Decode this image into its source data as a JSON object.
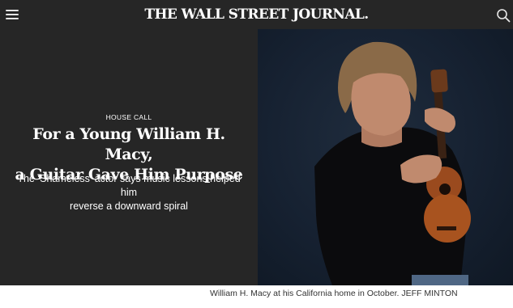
{
  "header": {
    "logo": "THE WALL STREET JOURNAL.",
    "menu_icon": "hamburger-menu-icon",
    "search_icon": "search-icon"
  },
  "article": {
    "kicker": "HOUSE CALL",
    "headline_line1": "For a Young William H. Macy,",
    "headline_line2": "a Guitar Gave Him Purpose",
    "dek_line1": "The ‘Shameless’ actor says music lessons helped him",
    "dek_line2": "reverse a downward spiral"
  },
  "photo": {
    "caption": "William H. Macy at his California home in October.",
    "credit": "JEFF MINTON"
  },
  "colors": {
    "header_bg": "#262626",
    "panel_bg": "#262626",
    "photo_bg": "#162131",
    "text_light": "#ffffff"
  }
}
